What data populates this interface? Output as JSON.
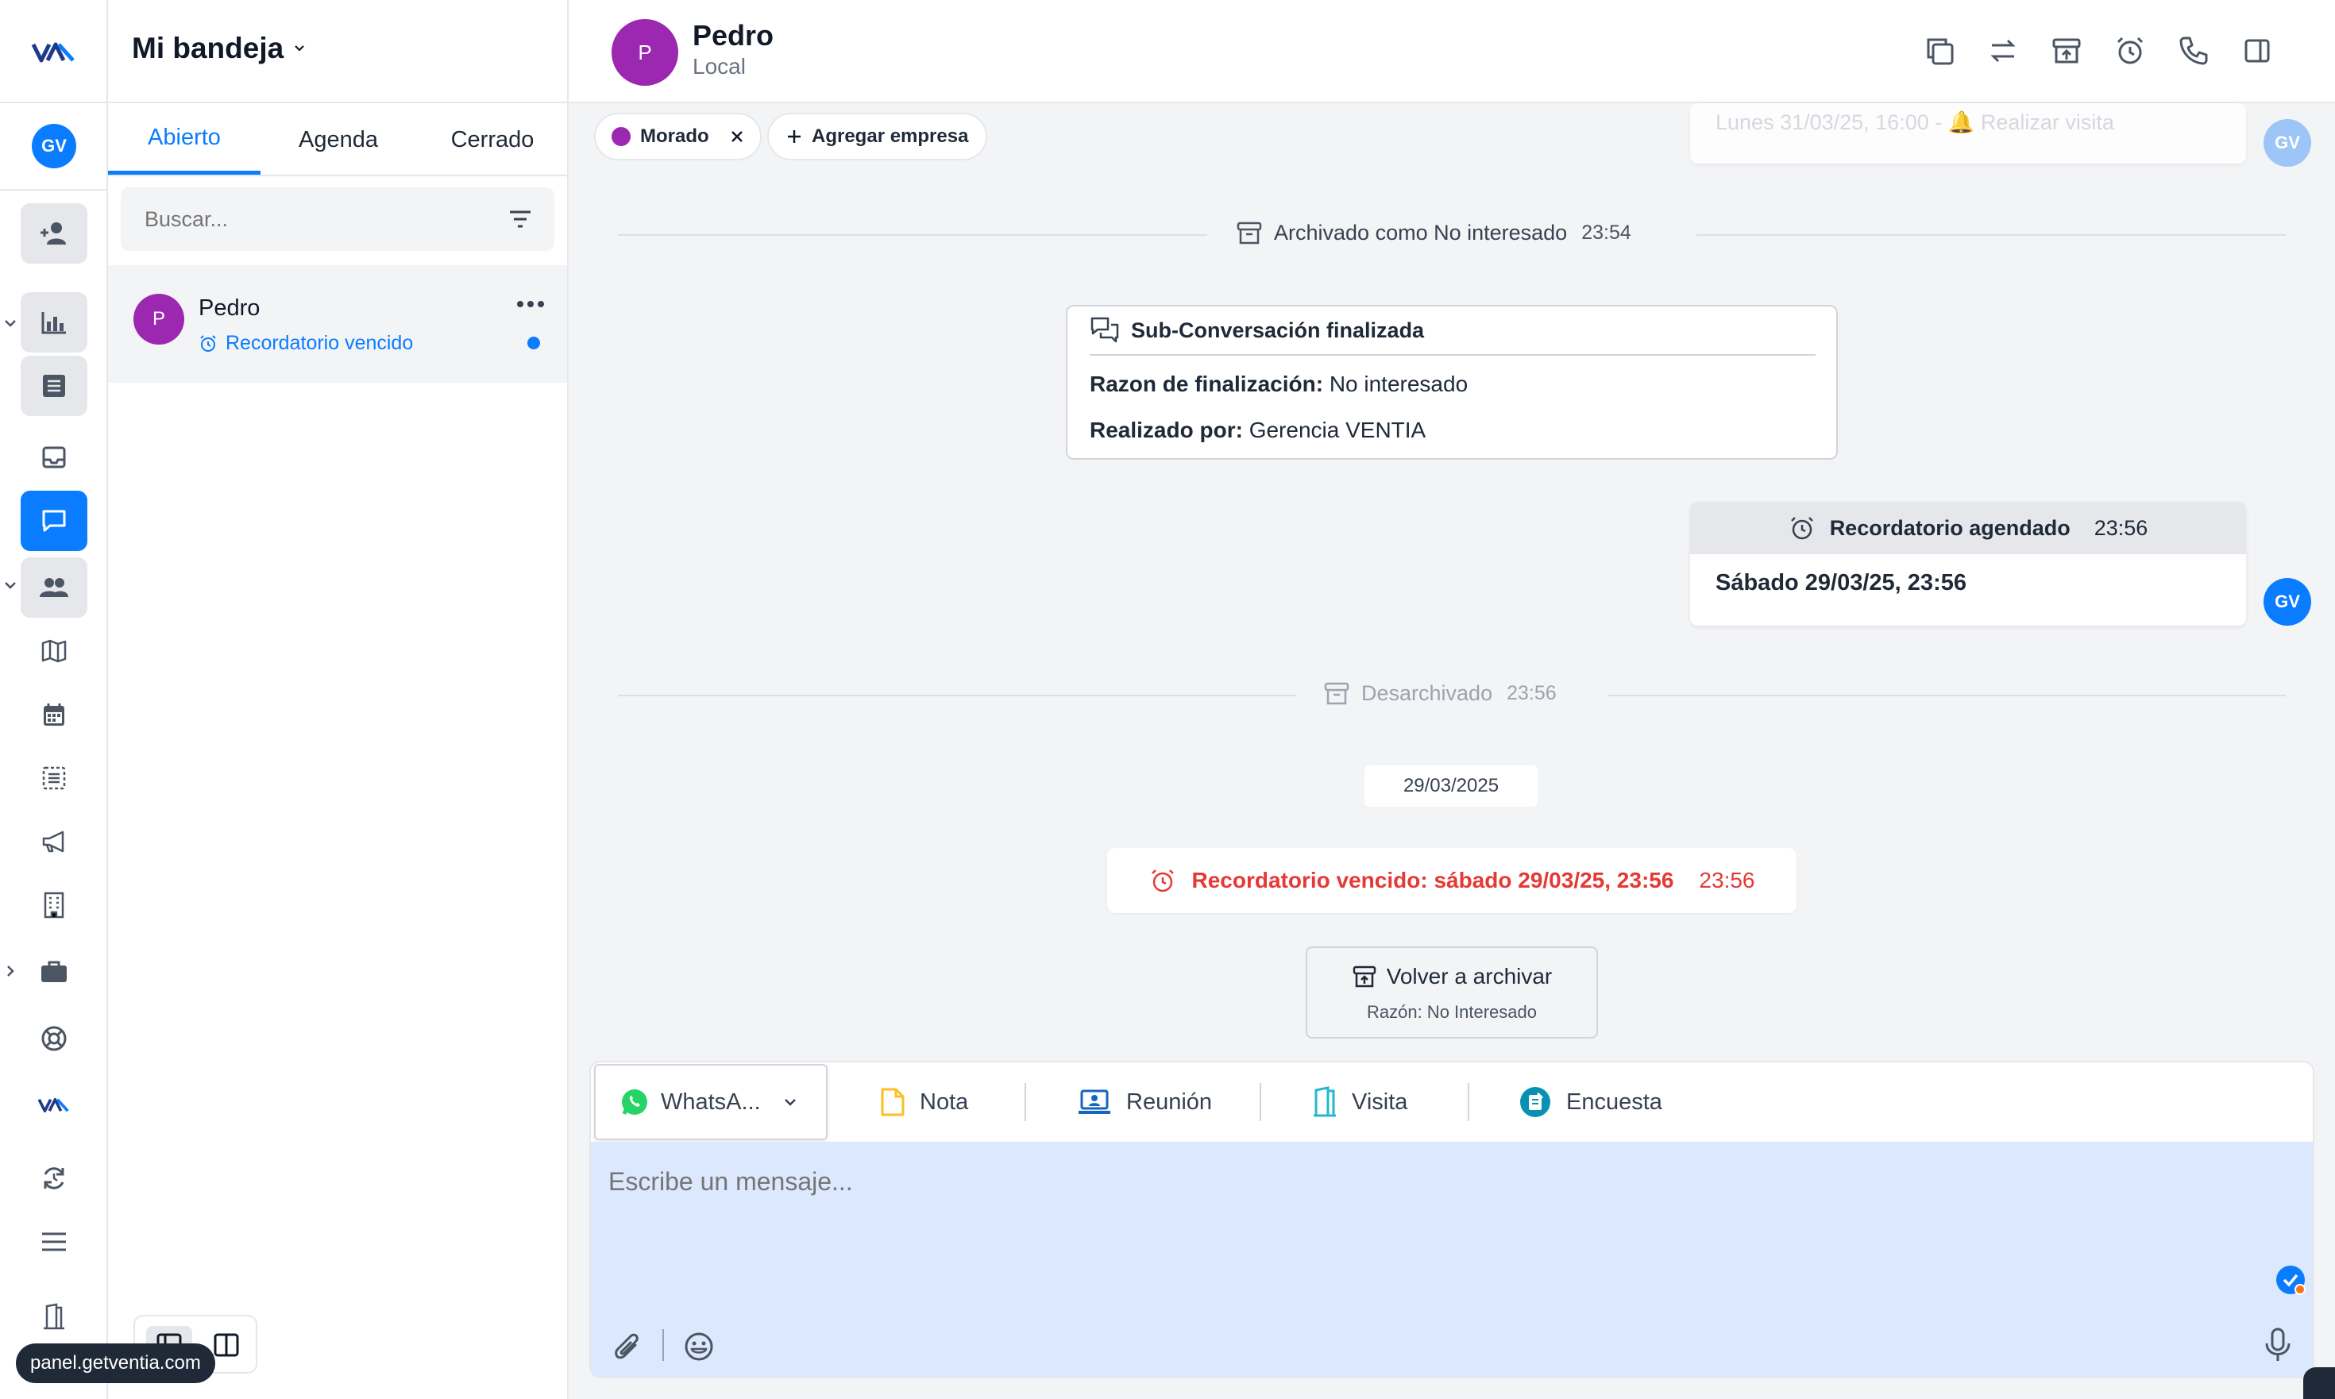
{
  "app": {
    "logo_text": "VA",
    "user_initials": "GV",
    "domain_tooltip": "panel.getventia.com"
  },
  "rail": {
    "icons": [
      "add-contact-icon",
      "bar-chart-icon",
      "list-icon",
      "inbox-icon",
      "chat-icon",
      "contacts-icon",
      "map-icon",
      "calendar-icon",
      "checklist-icon",
      "megaphone-icon",
      "building-icon",
      "briefcase-icon",
      "lifebuoy-icon",
      "ventia-logo-icon",
      "sync-icon",
      "menu-icon",
      "exit-door-icon"
    ]
  },
  "inbox": {
    "title": "Mi bandeja",
    "tabs": [
      {
        "label": "Abierto",
        "active": true
      },
      {
        "label": "Agenda",
        "active": false
      },
      {
        "label": "Cerrado",
        "active": false
      }
    ],
    "search_placeholder": "Buscar...",
    "conversations": [
      {
        "initial": "P",
        "name": "Pedro",
        "status": "Recordatorio vencido",
        "unread": true,
        "avatar_color": "#9c27b0"
      }
    ]
  },
  "contact": {
    "initial": "P",
    "name": "Pedro",
    "subtitle": "Local",
    "avatar_color": "#9c27b0"
  },
  "header_actions": [
    "copy-icon",
    "transfer-icon",
    "archive-icon",
    "alarm-icon",
    "phone-icon",
    "side-panel-icon"
  ],
  "tags": [
    {
      "label": "Morado",
      "color": "#9c27b0",
      "removable": true
    }
  ],
  "add_company_label": "Agregar empresa",
  "timeline": {
    "faded_top": "Lunes 31/03/25, 16:00 - 🔔 Realizar visita",
    "archived_event": {
      "text": "Archivado como No interesado",
      "time": "23:54"
    },
    "subconversation": {
      "title": "Sub-Conversación finalizada",
      "reason_label": "Razon de finalización:",
      "reason_value": "No interesado",
      "by_label": "Realizado por:",
      "by_value": "Gerencia VENTIA"
    },
    "reminder_scheduled": {
      "title": "Recordatorio agendado",
      "time": "23:56",
      "body": "Sábado 29/03/25, 23:56"
    },
    "unarchived_event": {
      "text": "Desarchivado",
      "time": "23:56"
    },
    "date_chip": "29/03/2025",
    "reminder_expired": {
      "text": "Recordatorio vencido: sábado 29/03/25, 23:56",
      "time": "23:56",
      "color": "#e53935"
    },
    "rearchive": {
      "label": "Volver a archivar",
      "sub": "Razón: No Interesado"
    }
  },
  "composer": {
    "channel": "WhatsA...",
    "tabs": [
      "Nota",
      "Reunión",
      "Visita",
      "Encuesta"
    ],
    "placeholder": "Escribe un mensaje...",
    "accent": "#0a7cff",
    "input_bg": "#dbe8fd"
  },
  "colors": {
    "primary": "#0a7cff",
    "avatar_purple": "#9c27b0",
    "danger": "#e53935"
  }
}
